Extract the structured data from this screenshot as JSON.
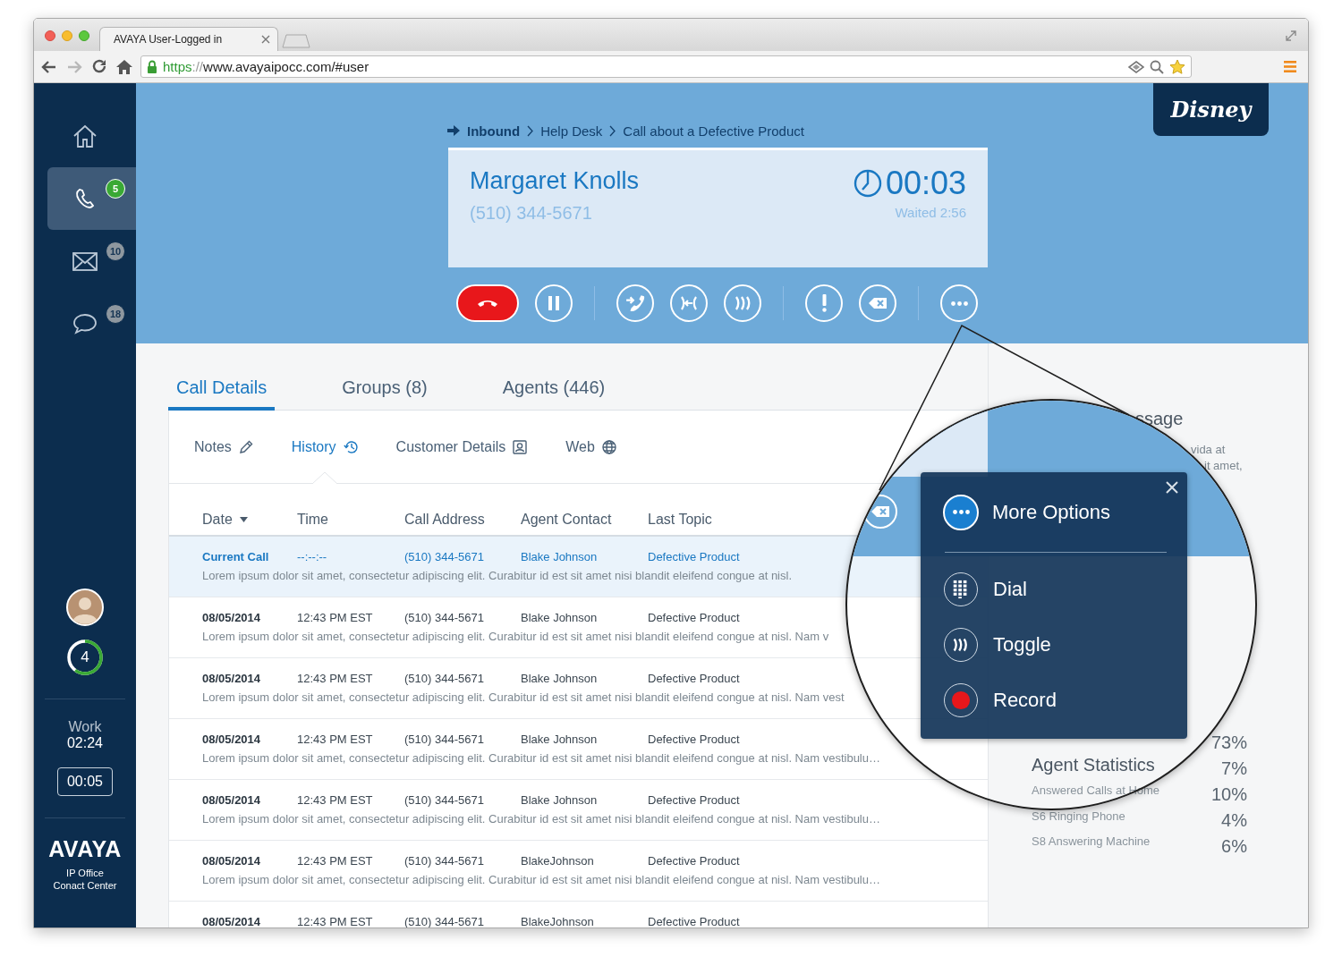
{
  "browser": {
    "tab_title": "AVAYA User-Logged in",
    "url": {
      "scheme": "https",
      "separator": "://",
      "rest": "www.avayaipocc.com/#user"
    }
  },
  "sidebar": {
    "items": [
      {
        "kind": "home",
        "selected": false
      },
      {
        "kind": "phone",
        "selected": true,
        "badge": "5",
        "color": "#3aa935"
      },
      {
        "kind": "mail",
        "selected": false,
        "badge": "10",
        "color": "#8e979f"
      },
      {
        "kind": "chat",
        "selected": false,
        "badge": "18",
        "color": "#8e979f"
      }
    ],
    "queue": {
      "count": "4",
      "level": 0.6
    },
    "status": {
      "label": "Work",
      "time": "02:24"
    },
    "timer": "00:05",
    "brand": {
      "logo": "AVAYA",
      "product": [
        "IP Office",
        "Conact Center"
      ]
    }
  },
  "header": {
    "logo": "Disney",
    "breadcrumb": [
      {
        "label": "Inbound",
        "kind": "origin"
      },
      {
        "label": "Help Desk",
        "kind": "step"
      },
      {
        "label": "Call about a Defective Product",
        "kind": "step"
      }
    ],
    "call": {
      "caller": "Margaret Knolls",
      "phone": "(510) 344-5671",
      "duration": "00:03",
      "waited": "Waited 2:56"
    },
    "controls": [
      [
        {
          "kind": "hangup"
        },
        {
          "kind": "hold"
        }
      ],
      [
        {
          "kind": "transfer"
        },
        {
          "kind": "conference"
        },
        {
          "kind": "toggle"
        }
      ],
      [
        {
          "kind": "alert"
        },
        {
          "kind": "exit"
        }
      ],
      [
        {
          "kind": "more"
        }
      ]
    ]
  },
  "tabs": [
    {
      "label": "Call Details",
      "selected": true
    },
    {
      "label": "Groups (8)",
      "selected": false
    },
    {
      "label": "Agents (446)",
      "selected": false
    }
  ],
  "subtabs": [
    {
      "label": "Notes",
      "kind": "notes",
      "selected": false
    },
    {
      "label": "History",
      "kind": "history",
      "selected": true
    },
    {
      "label": "Customer Details",
      "kind": "customer",
      "selected": false
    },
    {
      "label": "Web",
      "kind": "web",
      "selected": false
    }
  ],
  "table": {
    "columns": [
      {
        "label": "Date",
        "sorted": true
      },
      {
        "label": "Time",
        "sorted": false
      },
      {
        "label": "Call Address",
        "sorted": false
      },
      {
        "label": "Agent Contact",
        "sorted": false
      },
      {
        "label": "Last Topic",
        "sorted": false
      }
    ],
    "rows": [
      {
        "selected": true,
        "date": "Current Call",
        "time": "--:--:--",
        "address": "(510) 344-5671",
        "agent": "Blake Johnson",
        "topic": "Defective Product",
        "note": "Lorem ipsum dolor sit amet, consectetur adipiscing elit. Curabitur id est sit amet nisi blandit eleifend congue at nisl."
      },
      {
        "selected": false,
        "date": "08/05/2014",
        "time": "12:43 PM EST",
        "address": "(510) 344-5671",
        "agent": "Blake Johnson",
        "topic": "Defective Product",
        "note": "Lorem ipsum dolor sit amet, consectetur adipiscing elit. Curabitur id est sit amet nisi blandit eleifend congue at nisl. Nam v"
      },
      {
        "selected": false,
        "date": "08/05/2014",
        "time": "12:43 PM EST",
        "address": "(510) 344-5671",
        "agent": "Blake Johnson",
        "topic": "Defective Product",
        "note": "Lorem ipsum dolor sit amet, consectetur adipiscing elit. Curabitur id est sit amet nisi blandit eleifend congue at nisl. Nam vest"
      },
      {
        "selected": false,
        "date": "08/05/2014",
        "time": "12:43 PM EST",
        "address": "(510) 344-5671",
        "agent": "Blake Johnson",
        "topic": "Defective Product",
        "note": "Lorem ipsum dolor sit amet, consectetur adipiscing elit. Curabitur id est sit amet nisi blandit eleifend congue at nisl. Nam vestibulu…"
      },
      {
        "selected": false,
        "date": "08/05/2014",
        "time": "12:43 PM EST",
        "address": "(510) 344-5671",
        "agent": "Blake Johnson",
        "topic": "Defective Product",
        "note": "Lorem ipsum dolor sit amet, consectetur adipiscing elit. Curabitur id est sit amet nisi blandit eleifend congue at nisl. Nam vestibulu…"
      },
      {
        "selected": false,
        "date": "08/05/2014",
        "time": "12:43 PM EST",
        "address": "(510) 344-5671",
        "agent": "BlakeJohnson",
        "topic": "Defective Product",
        "note": "Lorem ipsum dolor sit amet, consectetur adipiscing elit. Curabitur id est sit amet nisi blandit eleifend congue at nisl. Nam vestibulu…"
      },
      {
        "selected": false,
        "date": "08/05/2014",
        "time": "12:43 PM EST",
        "address": "(510) 344-5671",
        "agent": "BlakeJohnson",
        "topic": "Defective Product"
      }
    ]
  },
  "side_panel": {
    "message_fragment": {
      "title": "ssage",
      "lines": [
        "vida at",
        "it amet,"
      ]
    },
    "stats": {
      "title": "Agent Statistics",
      "items": [
        "Answered Calls at Home",
        "S6 Ringing Phone",
        "S8 Answering Machine"
      ],
      "percentages": [
        "73%",
        "7%",
        "10%",
        "4%",
        "6%"
      ]
    }
  },
  "more_options": {
    "title": "More Options",
    "items": [
      {
        "label": "Dial",
        "kind": "dial"
      },
      {
        "label": "Toggle",
        "kind": "toggle"
      },
      {
        "label": "Record",
        "kind": "record"
      }
    ]
  }
}
